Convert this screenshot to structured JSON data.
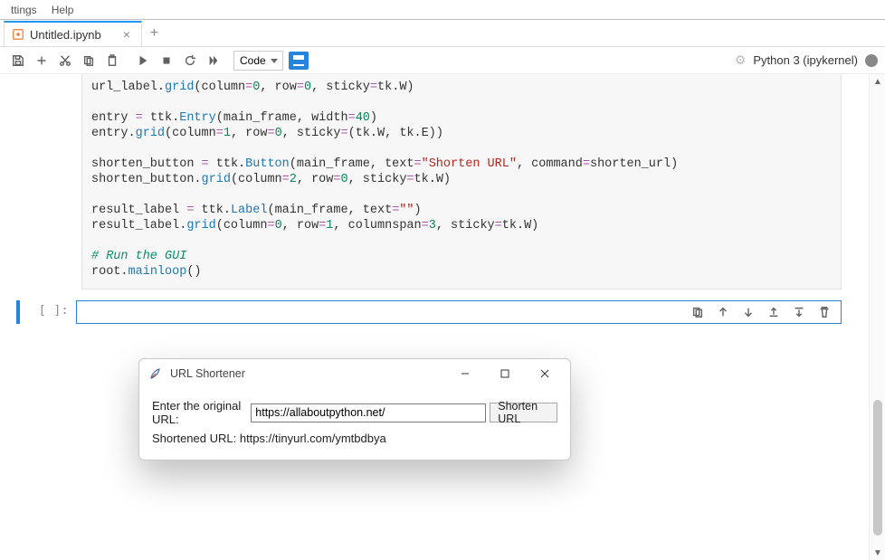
{
  "menubar": {
    "items": [
      "Settings",
      "Help"
    ],
    "settings_label": "ttings",
    "help_label": "Help"
  },
  "tab": {
    "title": "Untitled.ipynb"
  },
  "toolbar": {
    "celltype_selected": "Code"
  },
  "kernel": {
    "label": "Python 3 (ipykernel)"
  },
  "code": {
    "l1a": "url_label.",
    "l1b": "grid",
    "l1c": "(column",
    "l1d": "=",
    "l1e": "0",
    "l1f": ", row",
    "l1g": "=",
    "l1h": "0",
    "l1i": ", sticky",
    "l1j": "=",
    "l1k": "tk.W)",
    "l2": "",
    "l3a": "entry ",
    "l3b": "=",
    "l3c": " ttk.",
    "l3d": "Entry",
    "l3e": "(main_frame, width",
    "l3f": "=",
    "l3g": "40",
    "l3h": ")",
    "l4a": "entry.",
    "l4b": "grid",
    "l4c": "(column",
    "l4d": "=",
    "l4e": "1",
    "l4f": ", row",
    "l4g": "=",
    "l4h": "0",
    "l4i": ", sticky",
    "l4j": "=",
    "l4k": "(tk.W, tk.E))",
    "l5": "",
    "l6a": "shorten_button ",
    "l6b": "=",
    "l6c": " ttk.",
    "l6d": "Button",
    "l6e": "(main_frame, text",
    "l6f": "=",
    "l6g": "\"Shorten URL\"",
    "l6h": ", command",
    "l6i": "=",
    "l6j": "shorten_url)",
    "l7a": "shorten_button.",
    "l7b": "grid",
    "l7c": "(column",
    "l7d": "=",
    "l7e": "2",
    "l7f": ", row",
    "l7g": "=",
    "l7h": "0",
    "l7i": ", sticky",
    "l7j": "=",
    "l7k": "tk.W)",
    "l8": "",
    "l9a": "result_label ",
    "l9b": "=",
    "l9c": " ttk.",
    "l9d": "Label",
    "l9e": "(main_frame, text",
    "l9f": "=",
    "l9g": "\"\"",
    "l9h": ")",
    "l10a": "result_label.",
    "l10b": "grid",
    "l10c": "(column",
    "l10d": "=",
    "l10e": "0",
    "l10f": ", row",
    "l10g": "=",
    "l10h": "1",
    "l10i": ", columnspan",
    "l10j": "=",
    "l10k": "3",
    "l10l": ", sticky",
    "l10m": "=",
    "l10n": "tk.W)",
    "l11": "",
    "l12": "# Run the GUI",
    "l13a": "root.",
    "l13b": "mainloop",
    "l13c": "()"
  },
  "prompt": {
    "empty": "[ ]:"
  },
  "tk": {
    "title": "URL Shortener",
    "enter_label": "Enter the original URL:",
    "entry_value": "https://allaboutpython.net/",
    "button_label": "Shorten URL",
    "result_text": "Shortened URL: https://tinyurl.com/ymtbdbya"
  }
}
